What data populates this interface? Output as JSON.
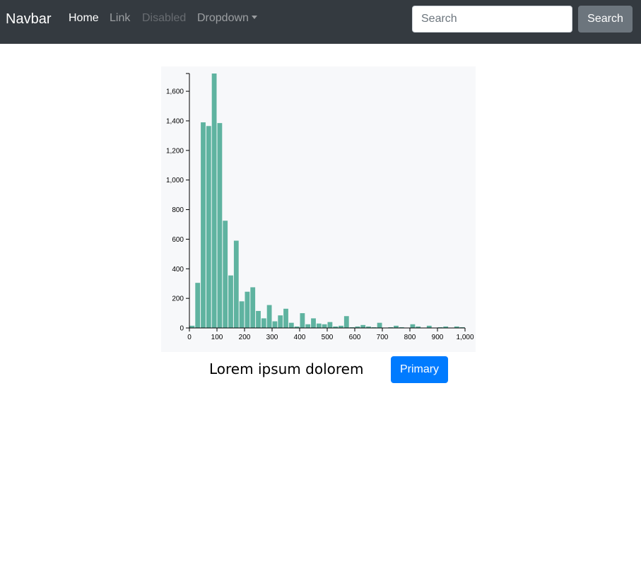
{
  "navbar": {
    "brand": "Navbar",
    "links": [
      {
        "label": "Home"
      },
      {
        "label": "Link"
      },
      {
        "label": "Disabled"
      },
      {
        "label": "Dropdown"
      }
    ],
    "search_placeholder": "Search",
    "search_button": "Search"
  },
  "main": {
    "caption": "Lorem ipsum dolorem",
    "primary_button": "Primary"
  },
  "colors": {
    "navbar_bg": "#343a40",
    "bar_fill": "#5fb3a0",
    "primary": "#007bff",
    "secondary": "#6c757d"
  },
  "chart_data": {
    "type": "bar",
    "x_ticks": [
      "0",
      "100",
      "200",
      "300",
      "400",
      "500",
      "600",
      "700",
      "800",
      "900",
      "1,000"
    ],
    "y_ticks": [
      "0",
      "200",
      "400",
      "600",
      "800",
      "1,000",
      "1,200",
      "1,400",
      "1,600"
    ],
    "xlim": [
      0,
      1000
    ],
    "ylim": [
      0,
      1720
    ],
    "bin_width": 20,
    "bins_start": [
      0,
      20,
      40,
      60,
      80,
      100,
      120,
      140,
      160,
      180,
      200,
      220,
      240,
      260,
      280,
      300,
      320,
      340,
      360,
      380,
      400,
      420,
      440,
      460,
      480,
      500,
      520,
      540,
      560,
      580,
      600,
      620,
      640,
      660,
      680,
      700,
      720,
      740,
      760,
      780,
      800,
      820,
      840,
      860,
      880,
      900,
      920,
      940,
      960,
      980
    ],
    "values": [
      15,
      305,
      1390,
      1365,
      1720,
      1385,
      725,
      355,
      590,
      180,
      245,
      275,
      115,
      65,
      155,
      45,
      85,
      130,
      35,
      10,
      100,
      25,
      65,
      30,
      25,
      40,
      10,
      15,
      80,
      5,
      10,
      20,
      10,
      5,
      35,
      0,
      5,
      15,
      5,
      0,
      25,
      10,
      0,
      15,
      0,
      5,
      10,
      0,
      10,
      5
    ],
    "title": "",
    "xlabel": "",
    "ylabel": "",
    "grid": false
  }
}
